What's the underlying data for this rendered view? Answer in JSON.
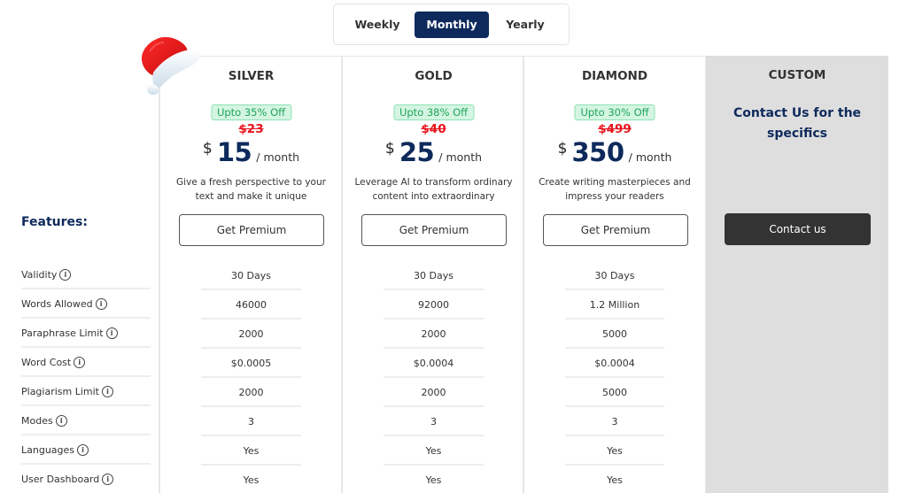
{
  "billing_toggle": {
    "options": [
      "Weekly",
      "Monthly",
      "Yearly"
    ],
    "selected": "Monthly"
  },
  "colors": {
    "brand_navy": "#0e2a5c",
    "discount_green": "#1fa55a",
    "old_price_red": "#e8141c",
    "custom_bg": "#dedede",
    "contact_button": "#333333"
  },
  "features": {
    "title": "Features:",
    "rows": [
      {
        "label": "Validity",
        "icon": "info-icon"
      },
      {
        "label": "Words Allowed",
        "icon": "info-icon"
      },
      {
        "label": "Paraphrase Limit",
        "icon": "info-icon"
      },
      {
        "label": "Word Cost",
        "icon": "info-icon"
      },
      {
        "label": "Plagiarism Limit",
        "icon": "info-icon"
      },
      {
        "label": "Modes",
        "icon": "info-icon"
      },
      {
        "label": "Languages",
        "icon": "info-icon"
      },
      {
        "label": "User Dashboard",
        "icon": "info-icon"
      }
    ]
  },
  "plans": [
    {
      "name": "SILVER",
      "discount": "Upto 35% Off",
      "old_price": "$23",
      "currency": "$",
      "price": "15",
      "period": "/ month",
      "description": "Give a fresh perspective to your text and make it unique",
      "button": "Get Premium",
      "values": [
        "30 Days",
        "46000",
        "2000",
        "$0.0005",
        "2000",
        "3",
        "Yes",
        "Yes"
      ]
    },
    {
      "name": "GOLD",
      "discount": "Upto 38% Off",
      "old_price": "$40",
      "currency": "$",
      "price": "25",
      "period": "/ month",
      "description": "Leverage AI to transform ordinary content into extraordinary",
      "button": "Get Premium",
      "values": [
        "30 Days",
        "92000",
        "2000",
        "$0.0004",
        "2000",
        "3",
        "Yes",
        "Yes"
      ]
    },
    {
      "name": "DIAMOND",
      "discount": "Upto 30% Off",
      "old_price": "$499",
      "currency": "$",
      "price": "350",
      "period": "/ month",
      "description": "Create writing masterpieces and impress your readers",
      "button": "Get Premium",
      "values": [
        "30 Days",
        "1.2 Million",
        "5000",
        "$0.0004",
        "5000",
        "3",
        "Yes",
        "Yes"
      ]
    }
  ],
  "custom": {
    "name": "CUSTOM",
    "heading": "Contact Us for the specifics",
    "button": "Contact us"
  },
  "decoration": {
    "icon": "santa-hat-icon"
  }
}
